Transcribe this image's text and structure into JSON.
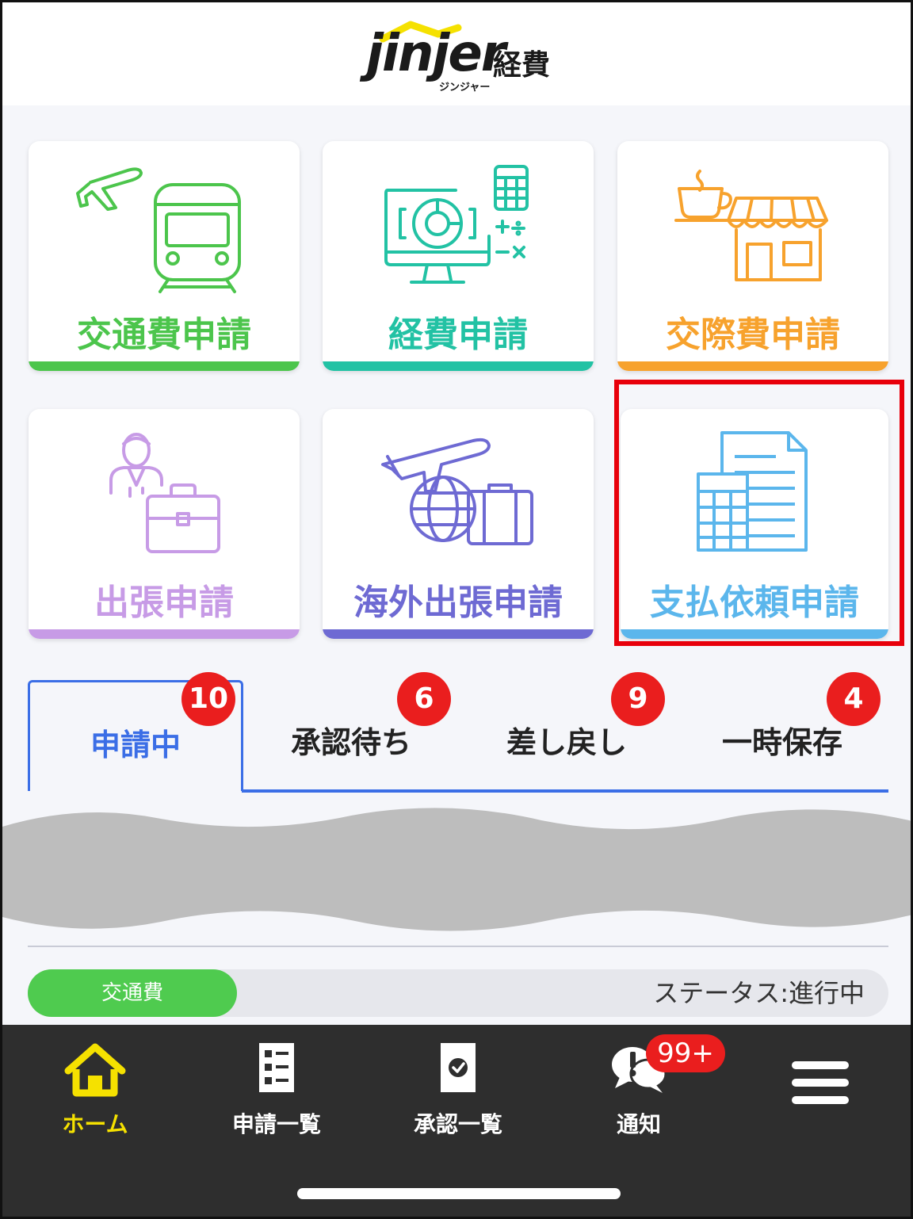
{
  "app": {
    "logo_text": "jinjer",
    "logo_product": "経費",
    "logo_kana": "ジンジャー"
  },
  "tiles": [
    {
      "label": "交通費申請",
      "color": "#4cc54c",
      "icon": "train-plane-icon"
    },
    {
      "label": "経費申請",
      "color": "#22c2a4",
      "icon": "monitor-calculator-icon"
    },
    {
      "label": "交際費申請",
      "color": "#f7a22d",
      "icon": "cafe-shop-icon"
    },
    {
      "label": "出張申請",
      "color": "#c79be6",
      "icon": "businessman-briefcase-icon"
    },
    {
      "label": "海外出張申請",
      "color": "#6e6ad3",
      "icon": "plane-globe-suitcase-icon"
    },
    {
      "label": "支払依頼申請",
      "color": "#5bb6ec",
      "icon": "calculator-document-icon"
    }
  ],
  "tabs": [
    {
      "label": "申請中",
      "badge": "10",
      "active": true
    },
    {
      "label": "承認待ち",
      "badge": "6",
      "active": false
    },
    {
      "label": "差し戻し",
      "badge": "9",
      "active": false
    },
    {
      "label": "一時保存",
      "badge": "4",
      "active": false
    }
  ],
  "record": {
    "category": "交通費",
    "status": "ステータス:進行中"
  },
  "bottom_nav": [
    {
      "label": "ホーム",
      "icon": "home-icon",
      "active": true
    },
    {
      "label": "申請一覧",
      "icon": "list-icon",
      "active": false
    },
    {
      "label": "承認一覧",
      "icon": "approval-icon",
      "active": false
    },
    {
      "label": "通知",
      "icon": "notification-icon",
      "active": false
    },
    {
      "label": "",
      "icon": "hamburger-menu-icon",
      "active": false
    }
  ],
  "notification_badge": "99+",
  "colors": {
    "accent_blue": "#3b6ee6",
    "badge_red": "#ea1e1e",
    "highlight_red": "#e8000b",
    "nav_active": "#f5e100"
  }
}
